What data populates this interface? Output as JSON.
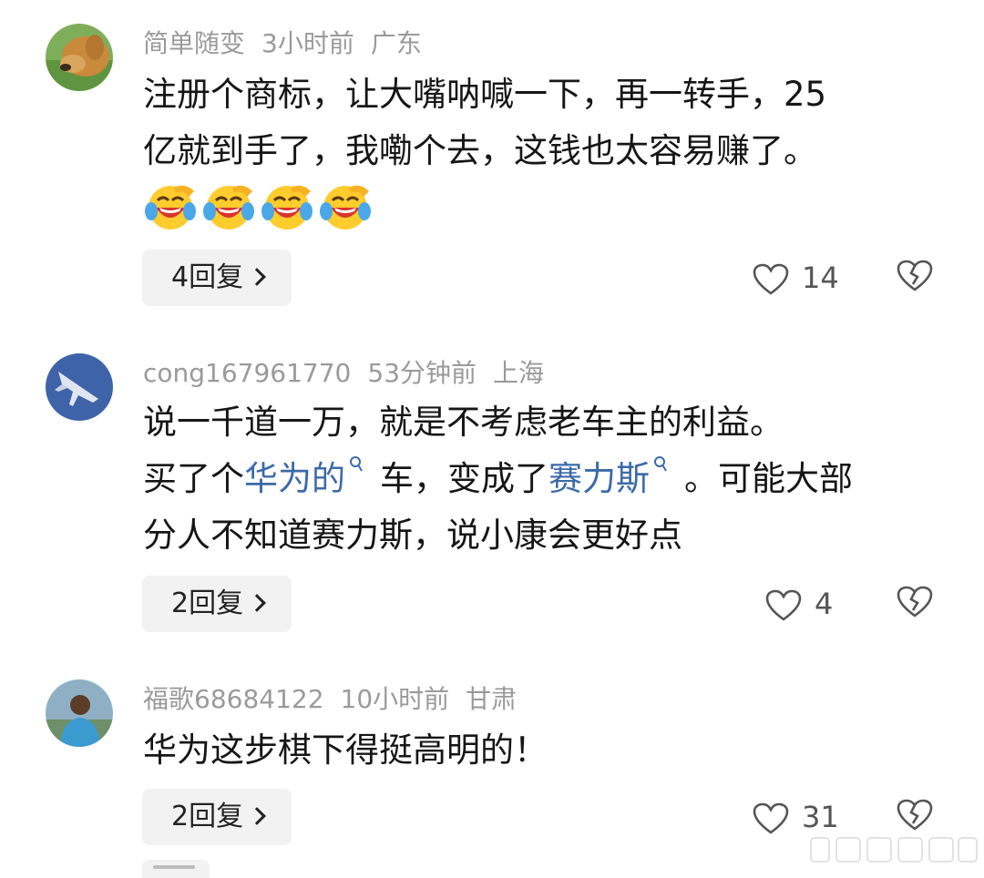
{
  "comments": [
    {
      "username": "简单随变",
      "time": "3小时前",
      "location": "广东",
      "lines": [
        "注册个商标，让大嘴呐喊一下，再一转手，25",
        "亿就到手了，我嘞个去，这钱也太容易赚了。"
      ],
      "emojis": [
        "laugh-cry-emoji",
        "laugh-cry-emoji",
        "laugh-cry-emoji",
        "laugh-cry-emoji"
      ],
      "reply_label": "4回复",
      "likes": "14"
    },
    {
      "username": "cong167961770",
      "time": "53分钟前",
      "location": "上海",
      "line1": "说一千道一万，就是不考虑老车主的利益。",
      "line2_a": "买了个",
      "line2_link1": "华为的",
      "line2_b": "车，变成了",
      "line2_link2": "赛力斯",
      "line2_c": "。可能大部",
      "line3": "分人不知道赛力斯，说小康会更好点",
      "reply_label": "2回复",
      "likes": "4"
    },
    {
      "username": "福歌68684122",
      "time": "10小时前",
      "location": "甘肃",
      "lines": [
        "华为这步棋下得挺高明的！"
      ],
      "reply_label": "2回复",
      "likes": "31"
    }
  ],
  "colors": {
    "meta": "#9a9a9a",
    "link": "#3c6aa8",
    "button_bg": "#f2f2f2"
  }
}
